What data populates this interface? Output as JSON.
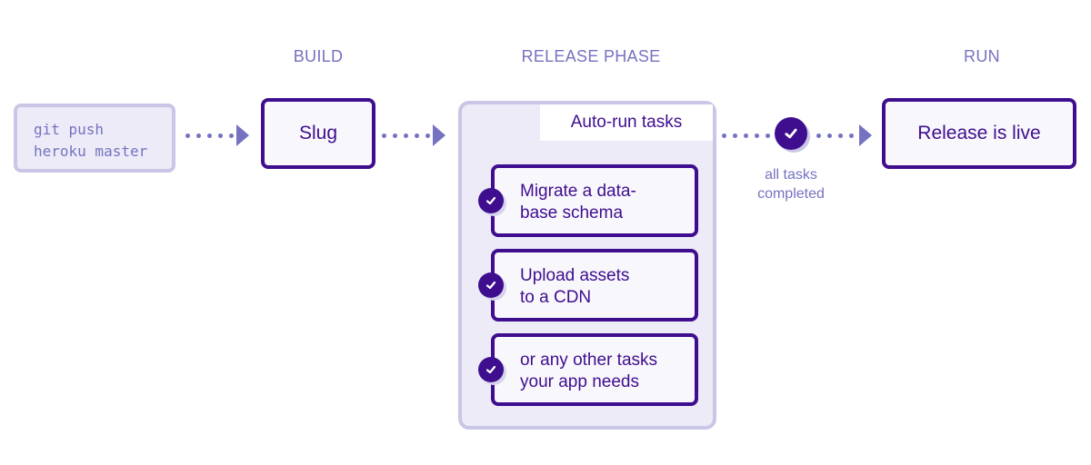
{
  "phases": {
    "build": "BUILD",
    "release": "RELEASE PHASE",
    "run": "RUN"
  },
  "source": {
    "line1": "git push",
    "line2": "heroku master"
  },
  "slug": "Slug",
  "release_panel": {
    "title": "Auto-run tasks",
    "tasks": [
      {
        "line1": "Migrate a data-",
        "line2": "base schema"
      },
      {
        "line1": "Upload assets",
        "line2": "to a CDN"
      },
      {
        "line1": "or any other tasks",
        "line2": "your app needs"
      }
    ]
  },
  "completion": {
    "line1": "all tasks",
    "line2": "completed",
    "icon": "check-circle-icon"
  },
  "live": "Release is live",
  "colors": {
    "primary": "#3f0e8f",
    "accent": "#7572c1",
    "panel_bg": "#ecebf7",
    "panel_border": "#c9c6e6"
  }
}
